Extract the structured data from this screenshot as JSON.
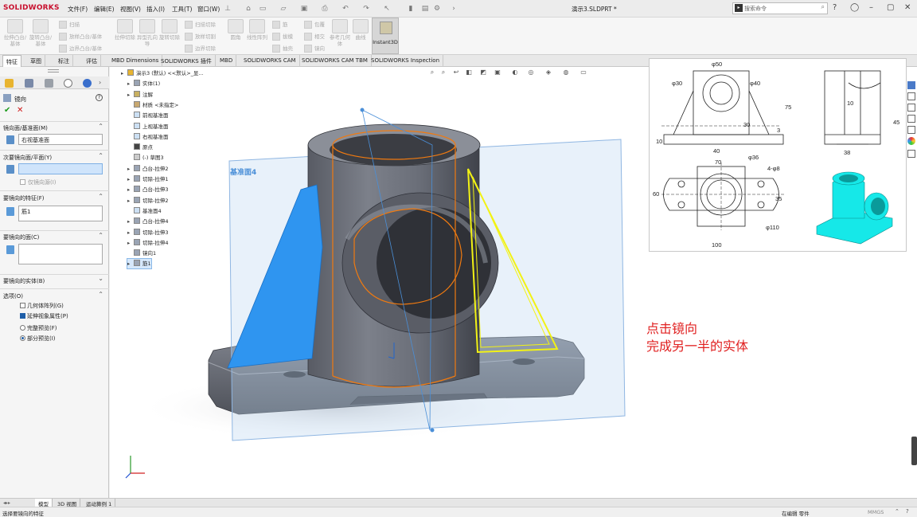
{
  "app": {
    "logo": "SOLIDWORKS",
    "menu": [
      "文件(F)",
      "编辑(E)",
      "视图(V)",
      "插入(I)",
      "工具(T)",
      "窗口(W)"
    ],
    "doc_title": "演示3.SLDPRT *",
    "search_placeholder": "搜索命令"
  },
  "ribbon": {
    "big_buttons": [
      "拉伸凸台/基体",
      "旋转凸台/基体",
      "拉伸切除",
      "异型孔向导",
      "旋转切除",
      "圆角",
      "线性阵列",
      "参考几何体",
      "曲线",
      "Instant3D"
    ],
    "small_buttons": [
      "扫描",
      "放样凸台/基体",
      "边界凸台/基体",
      "扫描切除",
      "放样切割",
      "边界切除",
      "筋",
      "拔模",
      "抽壳",
      "包覆",
      "相交",
      "镜向"
    ]
  },
  "tabs": [
    "特征",
    "草图",
    "标注",
    "评估",
    "MBD Dimensions",
    "SOLIDWORKS 插件",
    "MBD",
    "SOLIDWORKS CAM",
    "SOLIDWORKS CAM TBM",
    "SOLIDWORKS Inspection"
  ],
  "property_manager": {
    "title": "镜向",
    "mirror_plane_header": "镜向面/基准面(M)",
    "mirror_plane_value": "右视基准面",
    "secondary_plane_header": "次要镜向面/平面(Y)",
    "secondary_plane_value": "",
    "only_mirror": "仅镜向源(I)",
    "features_header": "要镜向的特征(F)",
    "features_value": "筋1",
    "faces_header": "要镜向的面(C)",
    "bodies_header": "要镜向的实体(B)",
    "options_header": "选项(O)",
    "opt_geometry_pattern": "几何体阵列(G)",
    "opt_propagate": "延伸视象属性(P)",
    "opt_full_preview": "完整预览(F)",
    "opt_partial_preview": "部分预览(I)"
  },
  "feature_tree": [
    {
      "label": "演示3 (默认) <<默认>_显...",
      "arrow": "▸"
    },
    {
      "label": "实体(1)",
      "arrow": "▸"
    },
    {
      "label": "注解",
      "arrow": "▸"
    },
    {
      "label": "材质 <未指定>",
      "arrow": ""
    },
    {
      "label": "前视基准面",
      "arrow": ""
    },
    {
      "label": "上视基准面",
      "arrow": ""
    },
    {
      "label": "右视基准面",
      "arrow": ""
    },
    {
      "label": "原点",
      "arrow": ""
    },
    {
      "label": "(-) 草图3",
      "arrow": ""
    },
    {
      "label": "凸台-拉伸2",
      "arrow": "▸"
    },
    {
      "label": "切除-拉伸1",
      "arrow": "▸"
    },
    {
      "label": "凸台-拉伸3",
      "arrow": "▸"
    },
    {
      "label": "切除-拉伸2",
      "arrow": "▸"
    },
    {
      "label": "基准面4",
      "arrow": ""
    },
    {
      "label": "凸台-拉伸4",
      "arrow": "▸"
    },
    {
      "label": "切除-拉伸3",
      "arrow": "▸"
    },
    {
      "label": "切除-拉伸4",
      "arrow": "▸"
    },
    {
      "label": "镜向1",
      "arrow": ""
    },
    {
      "label": "筋1",
      "arrow": "▸"
    }
  ],
  "viewport": {
    "plane_label": "基准面4",
    "annotation_line1": "点击镜向",
    "annotation_line2": "完成另一半的实体",
    "annotation_color": "#e02020"
  },
  "reference_drawing": {
    "dims": [
      "φ50",
      "φ30",
      "φ40",
      "75",
      "10",
      "30",
      "40",
      "3",
      "45",
      "10",
      "38",
      "70",
      "φ36",
      "4-φ8",
      "60",
      "35",
      "φ110",
      "100"
    ]
  },
  "bottom_tabs": [
    "模型",
    "3D 视图",
    "运动算例 1"
  ],
  "status": {
    "left": "选择要镜向的特征",
    "right1": "在编辑 零件",
    "right2": "MMGS"
  },
  "colors": {
    "rib_blue": "#2f95f0",
    "rib_yellow": "#f2f215",
    "preview_orange": "#f07a10",
    "body_gray": "#6c6f78",
    "ref_cyan": "#16e8e8"
  }
}
